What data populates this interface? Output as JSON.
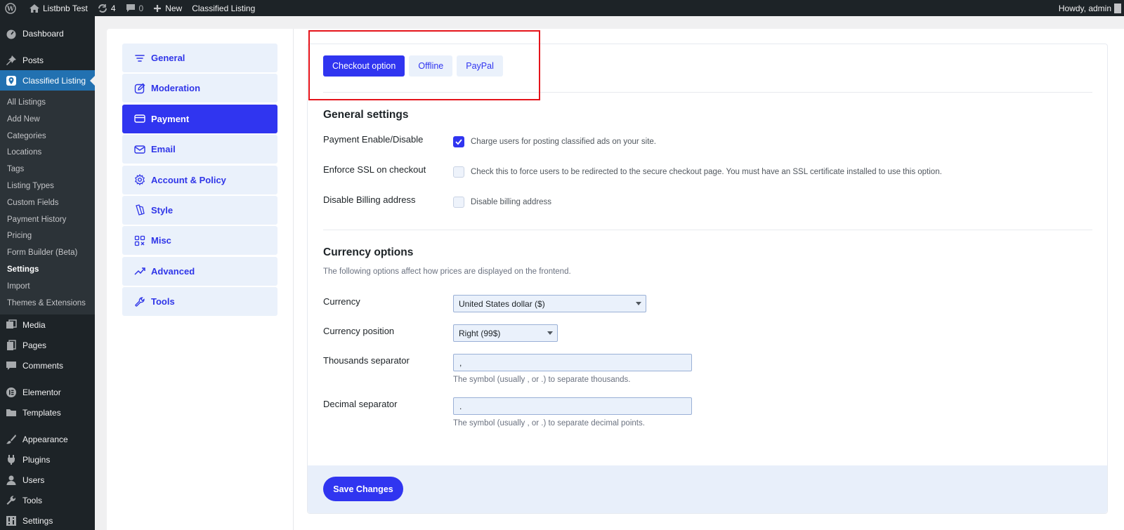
{
  "adminbar": {
    "site_name": "Listbnb Test",
    "updates_count": "4",
    "comments_count": "0",
    "new_label": "New",
    "plugin_label": "Classified Listing",
    "greeting": "Howdy, admin"
  },
  "menu": {
    "dashboard": "Dashboard",
    "posts": "Posts",
    "classified": "Classified Listing",
    "submenu": [
      "All Listings",
      "Add New",
      "Categories",
      "Locations",
      "Tags",
      "Listing Types",
      "Custom Fields",
      "Payment History",
      "Pricing",
      "Form Builder (Beta)",
      "Settings",
      "Import",
      "Themes & Extensions"
    ],
    "media": "Media",
    "pages": "Pages",
    "comments": "Comments",
    "elementor": "Elementor",
    "templates": "Templates",
    "appearance": "Appearance",
    "plugins": "Plugins",
    "users": "Users",
    "tools": "Tools",
    "settings": "Settings"
  },
  "settings_nav": [
    "General",
    "Moderation",
    "Payment",
    "Email",
    "Account & Policy",
    "Style",
    "Misc",
    "Advanced",
    "Tools"
  ],
  "tabs": [
    "Checkout option",
    "Offline",
    "PayPal"
  ],
  "general": {
    "title": "General settings",
    "payment_label": "Payment Enable/Disable",
    "payment_text": "Charge users for posting classified ads on your site.",
    "ssl_label": "Enforce SSL on checkout",
    "ssl_text": "Check this to force users to be redirected to the secure checkout page. You must have an SSL certificate installed to use this option.",
    "billing_label": "Disable Billing address",
    "billing_text": "Disable billing address"
  },
  "currency": {
    "title": "Currency options",
    "desc": "The following options affect how prices are displayed on the frontend.",
    "currency_label": "Currency",
    "currency_value": "United States dollar ($)",
    "position_label": "Currency position",
    "position_value": "Right (99$)",
    "thousands_label": "Thousands separator",
    "thousands_value": ",",
    "thousands_help": "The symbol (usually , or .) to separate thousands.",
    "decimal_label": "Decimal separator",
    "decimal_value": ".",
    "decimal_help": "The symbol (usually , or .) to separate decimal points."
  },
  "save_label": "Save Changes",
  "colors": {
    "accent": "#3035f0",
    "highlight": "#e5141b",
    "wp_blue": "#2271b1"
  }
}
